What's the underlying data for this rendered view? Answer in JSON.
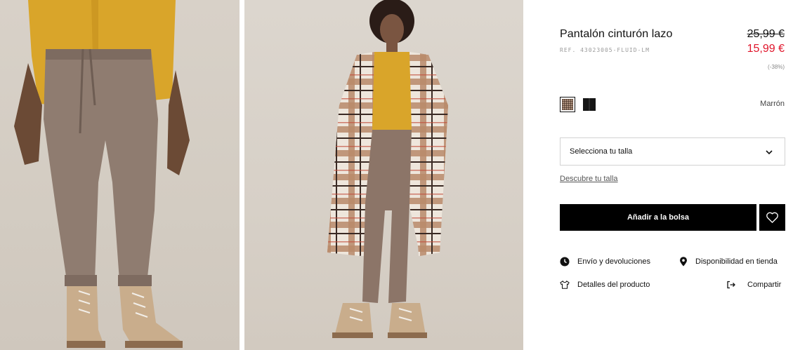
{
  "product": {
    "title": "Pantalón cinturón lazo",
    "reference": "REF. 43023005-FLUID-LM",
    "price_original": "25,99 €",
    "price_sale": "15,99 €",
    "discount": "(-38%)",
    "color_selected": "Marrón"
  },
  "swatches": [
    {
      "name": "check-pattern",
      "color": "#a88c78",
      "selected": true
    },
    {
      "name": "black",
      "color": "#151515",
      "selected": false
    }
  ],
  "size": {
    "select_label": "Selecciona tu talla",
    "guide_link": "Descubre tu talla"
  },
  "actions": {
    "add_to_bag": "Añadir a la bolsa"
  },
  "links": {
    "shipping": "Envío y devoluciones",
    "store_availability": "Disponibilidad en tienda",
    "details": "Detalles del producto",
    "share": "Compartir"
  },
  "icons": {
    "shipping": "clock-icon",
    "store_availability": "map-pin-icon",
    "details": "tshirt-icon",
    "share": "share-icon",
    "wishlist": "heart-icon",
    "select": "chevron-down-icon"
  },
  "colors": {
    "sale_price": "#e0152b",
    "button": "#000000",
    "text": "#111111"
  }
}
